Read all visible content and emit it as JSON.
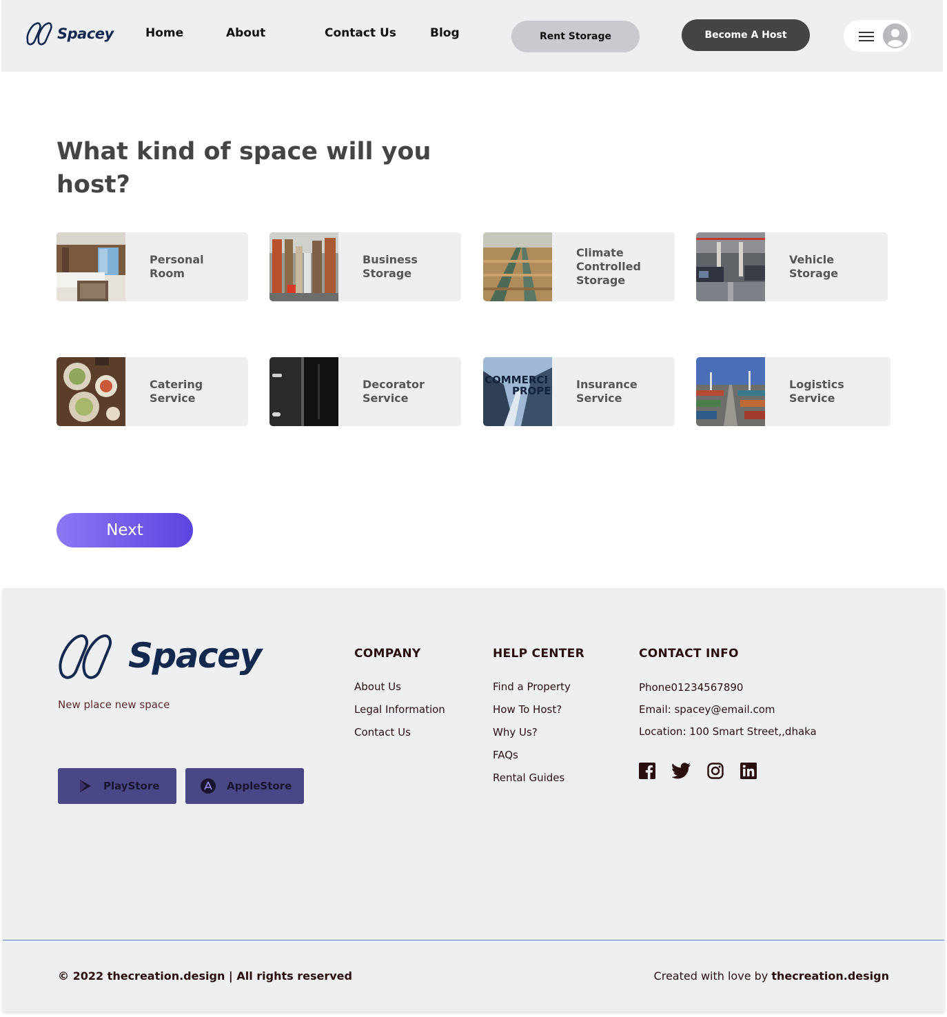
{
  "header": {
    "logo_text": "Spacey",
    "nav": [
      "Home",
      "About",
      "Contact Us",
      "Blog"
    ],
    "rent_label": "Rent Storage",
    "host_label": "Become A Host"
  },
  "main": {
    "title": "What kind of space will you host?",
    "cards": [
      {
        "label": "Personal\nRoom",
        "image": "hotel-bedroom-photo"
      },
      {
        "label": "Business\nStorage",
        "image": "warehouse-shelves-photo"
      },
      {
        "label": "Climate\nControlled\nStorage",
        "image": "produce-storage-photo"
      },
      {
        "label": "Vehicle\nStorage",
        "image": "parking-garage-photo"
      },
      {
        "label": "Catering\nService",
        "image": "food-platter-photo"
      },
      {
        "label": "Decorator\nService",
        "image": "dark-cabinet-photo"
      },
      {
        "label": "Insurance\nService",
        "image": "commercial-property-photo"
      },
      {
        "label": "Logistics\nService",
        "image": "container-port-photo"
      }
    ],
    "next_label": "Next"
  },
  "footer": {
    "logo_text": "Spacey",
    "tagline": "New place new  space",
    "playstore_label": "PlayStore",
    "applestore_label": "AppleStore",
    "company": {
      "title": "COMPANY",
      "links": [
        "About Us",
        "Legal Information",
        "Contact Us"
      ]
    },
    "help": {
      "title": "HELP CENTER",
      "links": [
        "Find a Property",
        "How To Host?",
        "Why Us?",
        "FAQs",
        "Rental Guides"
      ]
    },
    "contact": {
      "title": "CONTACT INFO",
      "lines": [
        "Phone01234567890",
        "Email: spacey@email.com",
        "Location: 100 Smart Street,,dhaka"
      ]
    },
    "social_icons": [
      "facebook-icon",
      "twitter-icon",
      "instagram-icon",
      "linkedin-icon"
    ],
    "copyright": "© 2022 thecreation.design | All rights reserved",
    "credits_prefix": "Created with love by ",
    "credits_name": "thecreation.design"
  },
  "colors": {
    "header_bg": "#eeeff1",
    "brand_navy": "#13284f",
    "next_gradient_start": "#8c77f5",
    "next_gradient_end": "#5b45e0",
    "store_button": "#4a4786",
    "dark_button": "#444444"
  }
}
